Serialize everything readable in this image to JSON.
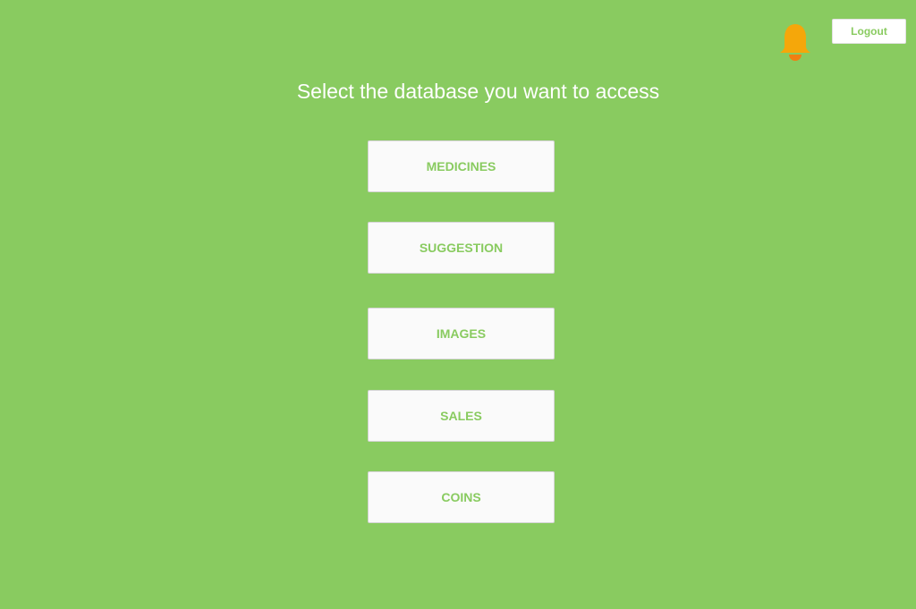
{
  "header": {
    "notification_icon": "bell-icon",
    "logout_label": "Logout"
  },
  "main": {
    "title": "Select the database you want to access",
    "databases": [
      {
        "label": "MEDICINES"
      },
      {
        "label": "SUGGESTION"
      },
      {
        "label": "IMAGES"
      },
      {
        "label": "SALES"
      },
      {
        "label": "COINS"
      }
    ]
  },
  "colors": {
    "background": "#89cb60",
    "accent_text": "#89cb60",
    "button_background": "#fafafa",
    "bell": "#f5a70a"
  }
}
